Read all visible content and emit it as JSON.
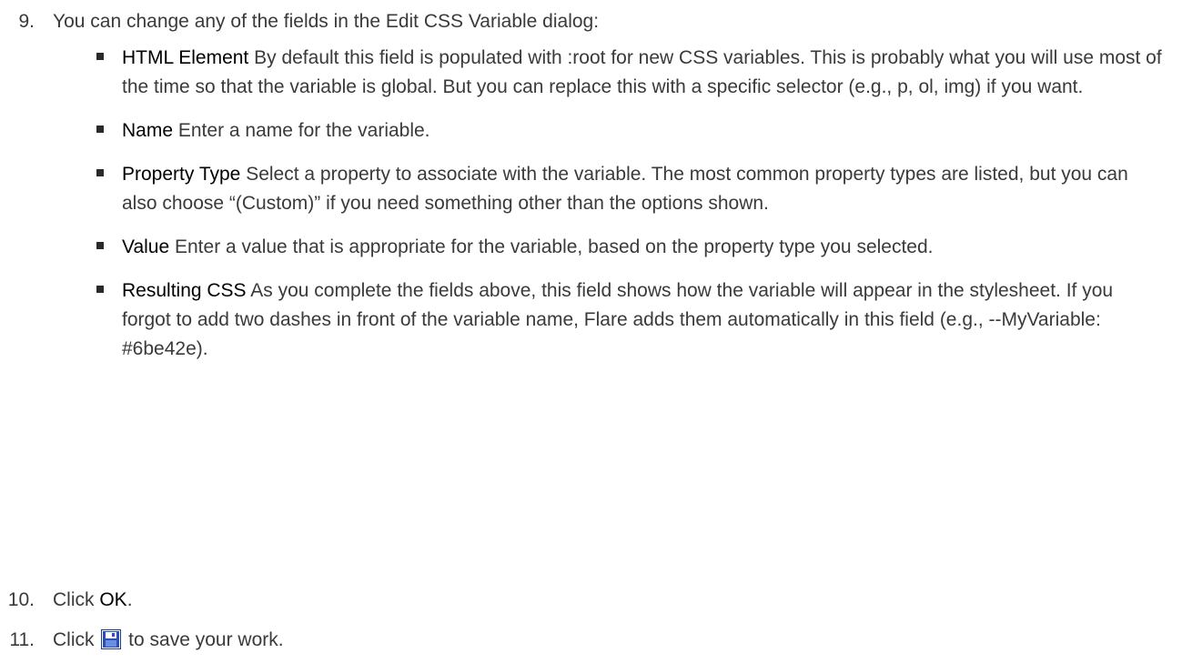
{
  "step9": {
    "number": "9.",
    "text": "You can change any of the fields in the Edit CSS Variable dialog:",
    "bullets": [
      {
        "term": "HTML Element",
        "text": " By default this field is populated with :root for new CSS variables. This is probably what you will use most of the time so that the variable is global. But you can replace this with a specific selector (e.g., p, ol, img) if you want."
      },
      {
        "term": "Name",
        "text": " Enter a name for the variable."
      },
      {
        "term": "Property Type",
        "text": " Select a property to associate with the variable. The most common property types are listed, but you can also choose “(Custom)” if you need something other than the options shown."
      },
      {
        "term": "Value",
        "text": " Enter a value that is appropriate for the variable, based on the property type you selected."
      },
      {
        "term": "Resulting CSS",
        "text": " As you complete the fields above, this field shows how the variable will appear in the stylesheet. If you forgot to add two dashes in front of the variable name, Flare adds them automatically in this field (e.g., --MyVariable: #6be42e)."
      }
    ]
  },
  "step10": {
    "number": "10.",
    "prefix": "Click ",
    "button": "OK",
    "suffix": "."
  },
  "step11": {
    "number": "11.",
    "prefix": "Click ",
    "icon": "save-icon",
    "suffix": " to save your work."
  }
}
